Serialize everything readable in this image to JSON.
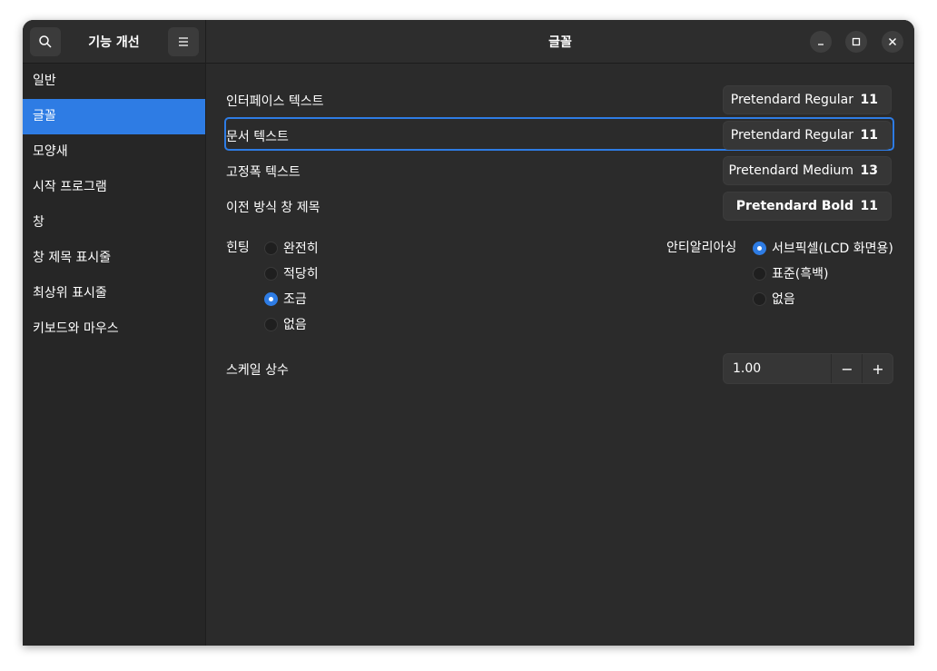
{
  "sidebar": {
    "title": "기능 개선",
    "items": [
      {
        "label": "일반",
        "active": false
      },
      {
        "label": "글꼴",
        "active": true
      },
      {
        "label": "모양새",
        "active": false
      },
      {
        "label": "시작 프로그램",
        "active": false
      },
      {
        "label": "창",
        "active": false
      },
      {
        "label": "창 제목 표시줄",
        "active": false
      },
      {
        "label": "최상위 표시줄",
        "active": false
      },
      {
        "label": "키보드와 마우스",
        "active": false
      }
    ]
  },
  "header": {
    "title": "글꼴"
  },
  "fonts": [
    {
      "label": "인터페이스 텍스트",
      "font": "Pretendard Regular",
      "size": "11"
    },
    {
      "label": "문서 텍스트",
      "font": "Pretendard Regular",
      "size": "11"
    },
    {
      "label": "고정폭 텍스트",
      "font": "Pretendard Medium",
      "size": "13"
    },
    {
      "label": "이전 방식 창 제목",
      "font": "Pretendard Bold",
      "size": "11"
    }
  ],
  "hinting": {
    "label": "힌팅",
    "options": [
      "완전히",
      "적당히",
      "조금",
      "없음"
    ],
    "selected": "조금"
  },
  "antialiasing": {
    "label": "안티알리아싱",
    "options": [
      "서브픽셀(LCD 화면용)",
      "표준(흑백)",
      "없음"
    ],
    "selected": "서브픽셀(LCD 화면용)"
  },
  "scale": {
    "label": "스케일 상수",
    "value": "1.00",
    "minus": "−",
    "plus": "+"
  },
  "colors": {
    "accent": "#2e7ce4",
    "bg": "#2b2b2b",
    "sidebar": "#262626"
  }
}
